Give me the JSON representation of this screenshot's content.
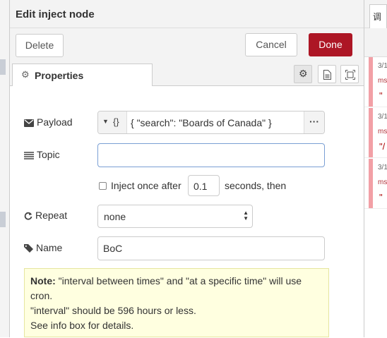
{
  "title": "Edit inject node",
  "toolbar": {
    "delete_label": "Delete",
    "cancel_label": "Cancel",
    "done_label": "Done"
  },
  "tabs": {
    "properties_label": "Properties"
  },
  "form": {
    "payload": {
      "label": "Payload",
      "type_glyph": "{}",
      "value": "{ \"search\": \"Boards of Canada\" }",
      "more": "···"
    },
    "topic": {
      "label": "Topic",
      "value": ""
    },
    "inject_once": {
      "checked": false,
      "before": "Inject once after",
      "delay": "0.1",
      "after": "seconds, then"
    },
    "repeat": {
      "label": "Repeat",
      "value": "none"
    },
    "name": {
      "label": "Name",
      "value": "BoC"
    }
  },
  "note": {
    "bold": "Note:",
    "line1": " \"interval between times\" and \"at a specific time\" will use cron.",
    "line2": "\"interval\" should be 596 hours or less.",
    "line3": "See info box for details."
  },
  "sidebar": {
    "tab_glyph": "调",
    "entries": [
      {
        "time": "3/1",
        "source": "ms",
        "preview": "\""
      },
      {
        "time": "3/1",
        "source": "ms",
        "preview": "\"/"
      },
      {
        "time": "3/1",
        "source": "ms",
        "preview": "\""
      }
    ]
  },
  "colors": {
    "done": "#ad1625",
    "note_bg": "#ffffe0",
    "debug_bar": "#f2a0a6"
  },
  "icons": [
    "gear-icon",
    "description-icon",
    "appearance-icon",
    "envelope-icon",
    "list-icon",
    "repeat-icon",
    "tag-icon",
    "ellipsis-icon"
  ]
}
